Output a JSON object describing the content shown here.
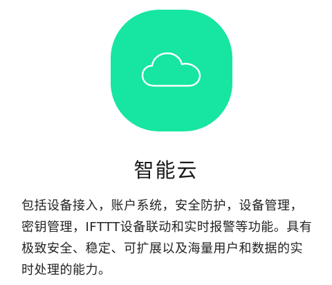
{
  "feature": {
    "icon": "cloud-icon",
    "accent_color": "#16e6a1",
    "title": "智能云",
    "description": "包括设备接入，账户系统，安全防护，设备管理，密钥管理，IFTTT设备联动和实时报警等功能。具有极致安全、稳定、可扩展以及海量用户和数据的实时处理的能力。"
  }
}
